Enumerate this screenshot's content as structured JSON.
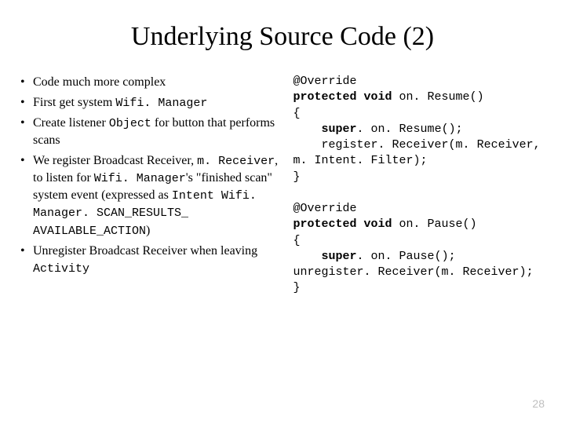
{
  "title": "Underlying Source Code (2)",
  "bullets": {
    "b1": "Code much more complex",
    "b2_a": "First get system ",
    "b2_mono": "Wifi. Manager",
    "b3_a": "Create listener ",
    "b3_mono": "Object",
    "b3_b": " for button that performs scans",
    "b4_a": "We register Broadcast Receiver, ",
    "b4_mono1": "m. Receiver",
    "b4_b": ", to listen for ",
    "b4_mono2": "Wifi. Manager",
    "b4_c": "'s \"finished scan\" system event (expressed as ",
    "b4_mono3": "Intent Wifi. Manager. SCAN_RESULTS_ AVAILABLE_ACTION",
    "b4_d": ")",
    "b5_a": "Unregister Broadcast Receiver when leaving ",
    "b5_mono": "Activity"
  },
  "code": {
    "l1": "@Override",
    "l2a": "protected void",
    "l2b": " on. Resume()",
    "l3": "{",
    "l4a": "    super",
    "l4b": ". on. Resume();",
    "l5": "    register. Receiver(m. Receiver, m. Intent. Filter);",
    "l6": "}",
    "blank": " ",
    "l7": "@Override",
    "l8a": "protected void",
    "l8b": " on. Pause()",
    "l9": "{",
    "l10a": "    super",
    "l10b": ". on. Pause();",
    "l11": "unregister. Receiver(m. Receiver);",
    "l12": "}"
  },
  "page_number": "28"
}
